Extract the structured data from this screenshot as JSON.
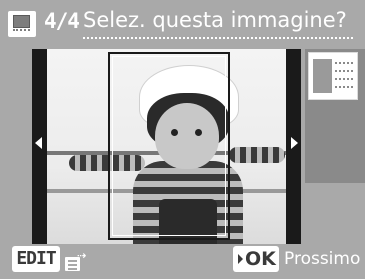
{
  "header": {
    "page_counter": "4/4",
    "title": "Selez. questa immagine?",
    "icon": "print-layout-icon"
  },
  "photo": {
    "nav_prev_icon": "arrow-left-icon",
    "nav_next_icon": "arrow-right-icon"
  },
  "layout_preview": {
    "icon": "layout-thumbnail-icon"
  },
  "footer": {
    "edit_label": "EDIT",
    "edit_icon": "edit-document-icon",
    "ok_label": "OK",
    "ok_icon": "triangle-right-icon",
    "next_label": "Prossimo"
  },
  "colors": {
    "background": "#a9a9a9",
    "text": "#ffffff",
    "button_bg": "#ffffff",
    "button_text": "#3a3a3a"
  }
}
